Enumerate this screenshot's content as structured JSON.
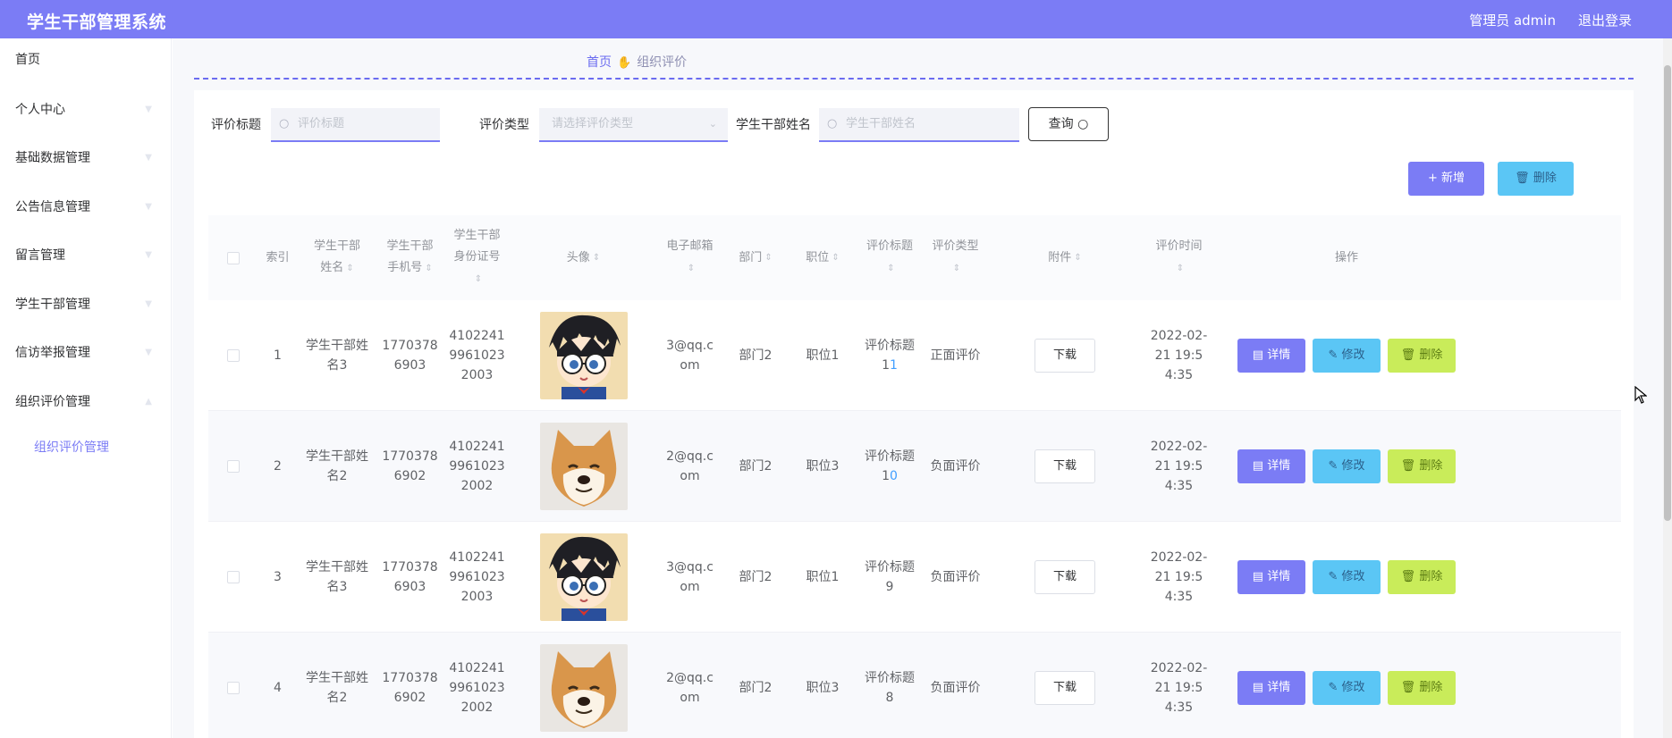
{
  "app": {
    "title": "学生干部管理系统",
    "user_label": "管理员 admin",
    "logout": "退出登录"
  },
  "sidebar": {
    "items": [
      {
        "label": "首页"
      },
      {
        "label": "个人中心"
      },
      {
        "label": "基础数据管理"
      },
      {
        "label": "公告信息管理"
      },
      {
        "label": "留言管理"
      },
      {
        "label": "学生干部管理"
      },
      {
        "label": "信访举报管理"
      },
      {
        "label": "组织评价管理"
      }
    ],
    "sub_item": "组织评价管理"
  },
  "breadcrumb": {
    "home": "首页",
    "current": "组织评价"
  },
  "search": {
    "title_label": "评价标题",
    "title_placeholder": "评价标题",
    "type_label": "评价类型",
    "type_placeholder": "请选择评价类型",
    "name_label": "学生干部姓名",
    "name_placeholder": "学生干部姓名",
    "query_button": "查询"
  },
  "toolbar": {
    "add": "新增",
    "delete": "删除"
  },
  "table": {
    "headers": {
      "index": "索引",
      "name": "学生干部姓名",
      "phone": "学生干部手机号",
      "idcard": "学生干部身份证号",
      "avatar": "头像",
      "email": "电子邮箱",
      "dept": "部门",
      "position": "职位",
      "title": "评价标题",
      "type": "评价类型",
      "attachment": "附件",
      "time": "评价时间",
      "ops": "操作"
    },
    "download_label": "下载",
    "op_detail": "详情",
    "op_edit": "修改",
    "op_delete": "删除",
    "rows": [
      {
        "index": "1",
        "name": "学生干部姓名3",
        "phone": "17703786903",
        "idcard": "410224199610232003",
        "avatar": "conan",
        "email": "3@qq.com",
        "dept": "部门2",
        "position": "职位1",
        "title_prefix": "评价标题1",
        "title_link": "1",
        "type": "正面评价",
        "time": "2022-02-21 19:54:35"
      },
      {
        "index": "2",
        "name": "学生干部姓名2",
        "phone": "17703786902",
        "idcard": "410224199610232002",
        "avatar": "shiba",
        "email": "2@qq.com",
        "dept": "部门2",
        "position": "职位3",
        "title_prefix": "评价标题1",
        "title_link": "0",
        "type": "负面评价",
        "time": "2022-02-21 19:54:35"
      },
      {
        "index": "3",
        "name": "学生干部姓名3",
        "phone": "17703786903",
        "idcard": "410224199610232003",
        "avatar": "conan",
        "email": "3@qq.com",
        "dept": "部门2",
        "position": "职位1",
        "title_prefix": "评价标题9",
        "title_link": "",
        "type": "负面评价",
        "time": "2022-02-21 19:54:35"
      },
      {
        "index": "4",
        "name": "学生干部姓名2",
        "phone": "17703786902",
        "idcard": "410224199610232002",
        "avatar": "shiba",
        "email": "2@qq.com",
        "dept": "部门2",
        "position": "职位3",
        "title_prefix": "评价标题8",
        "title_link": "",
        "type": "负面评价",
        "time": "2022-02-21 19:54:35"
      }
    ]
  },
  "colors": {
    "primary": "#7b7cf5",
    "info": "#5bc6f5",
    "danger": "#c9ec5a"
  }
}
